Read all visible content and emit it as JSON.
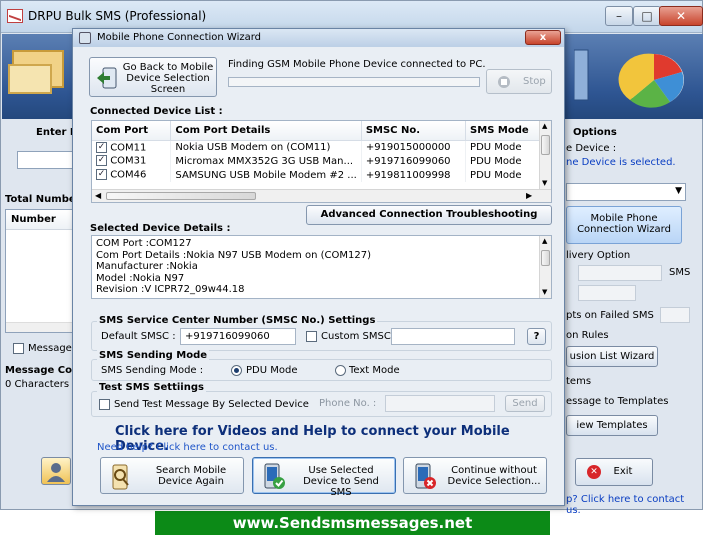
{
  "app": {
    "title": "DRPU Bulk SMS (Professional)"
  },
  "background": {
    "enter_label": "Enter R",
    "total_number_label": "Total Number",
    "number_header": "Number",
    "message_checkbox_label": "Message c",
    "message_composer_label": "Message Com",
    "characters_label": "0 Characters",
    "options_label": "Options",
    "device_label": "e Device :",
    "device_selected_text": "ne Device is selected.",
    "mobile_phone_wizard_btn": "Mobile Phone Connection  Wizard",
    "delivery_option_label": "livery Option",
    "sms_label": "SMS",
    "failed_sms_label": "pts on Failed SMS",
    "rules_label": "on Rules",
    "exclusion_wizard_btn": "usion List Wizard",
    "items_label": "tems",
    "templates_label": "essage to Templates",
    "view_templates_btn": "iew Templates",
    "exit_btn": "Exit",
    "help_link": "p? Click here to contact us."
  },
  "footer": {
    "website": "www.Sendsmsmessages.net"
  },
  "wizard": {
    "title": "Mobile Phone Connection Wizard",
    "close_symbol": "x",
    "back_button": "Go Back to Mobile Device Selection Screen",
    "status_text": "Finding GSM Mobile Phone Device connected to PC.",
    "stop_button": "Stop",
    "progress": 0,
    "device_list_label": "Connected Device List :",
    "columns": [
      "Com Port",
      "Com Port Details",
      "SMSC No.",
      "SMS Mode"
    ],
    "devices": [
      {
        "checked": true,
        "port": "COM11",
        "details": "Nokia USB Modem on (COM11)",
        "smsc": "+919015000000",
        "mode": "PDU Mode"
      },
      {
        "checked": true,
        "port": "COM31",
        "details": "Micromax MMX352G 3G USB Man...",
        "smsc": "+919716099060",
        "mode": "PDU Mode"
      },
      {
        "checked": true,
        "port": "COM46",
        "details": "SAMSUNG USB Mobile Modem #2 ...",
        "smsc": "+919811009998",
        "mode": "PDU Mode"
      }
    ],
    "advanced_button": "Advanced Connection Troubleshooting",
    "selected_details_label": "Selected Device Details :",
    "selected_details_lines": [
      "COM Port :COM127",
      "Com Port Details :Nokia N97 USB Modem on (COM127)",
      "Manufacturer :Nokia",
      "Model :Nokia N97",
      "Revision :V ICPR72_09w44.18"
    ],
    "smsc_group_title": "SMS Service Center Number (SMSC No.) Settings",
    "default_smsc_label": "Default SMSC :",
    "default_smsc_value": "+919716099060",
    "custom_smsc_label": "Custom SMSC :",
    "custom_smsc_help": "?",
    "sending_mode_title": "SMS Sending Mode",
    "sending_mode_label": "SMS Sending Mode :",
    "pdu_mode_label": "PDU Mode",
    "text_mode_label": "Text Mode",
    "selected_mode": "pdu",
    "test_group_title": "Test SMS Settiings",
    "test_checkbox_label": "Send Test Message By Selected Device",
    "phone_no_label": "Phone No. :",
    "send_button": "Send",
    "help_banner": "Click here for Videos and Help to connect your Mobile Device.",
    "need_help_text": "Need help? Click here to contact us.",
    "search_again_button": "Search Mobile Device Again",
    "use_selected_button": "Use Selected Device to Send SMS",
    "continue_without_button": "Continue without Device Selection..."
  }
}
